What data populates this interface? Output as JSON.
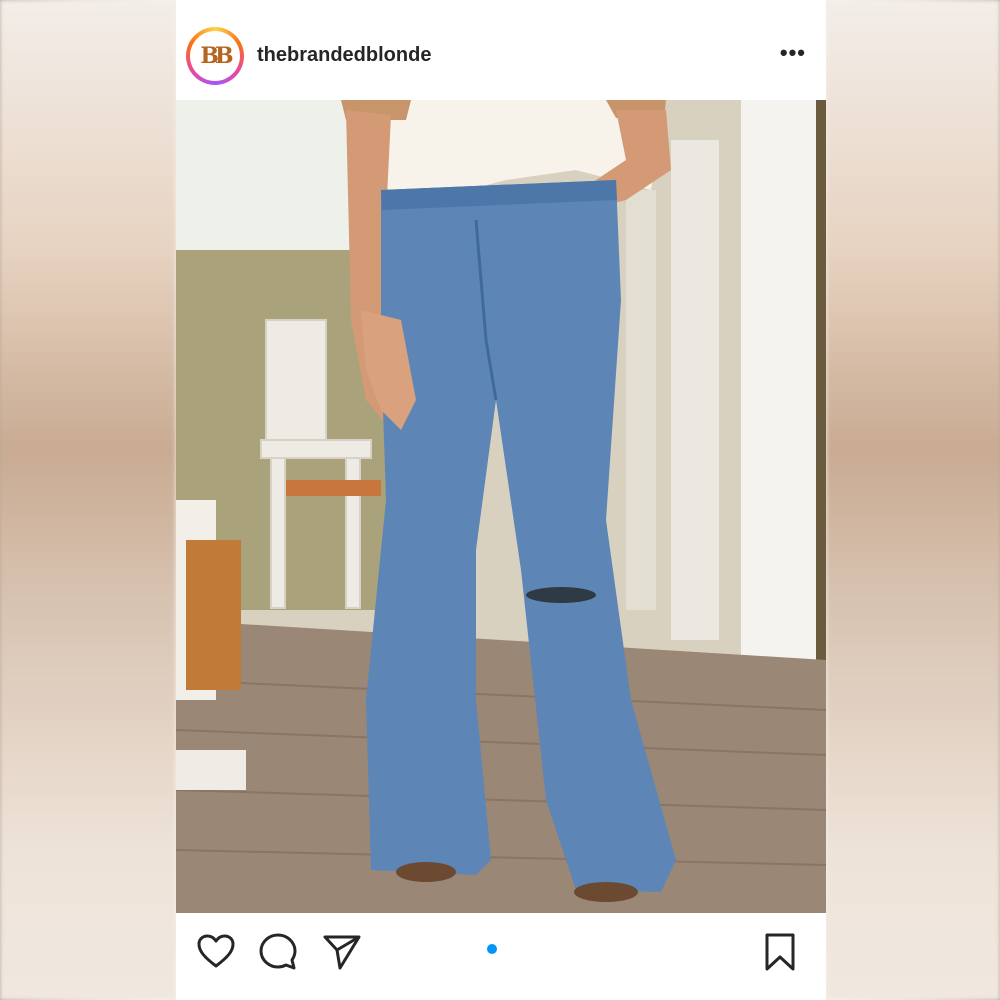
{
  "post": {
    "username": "thebrandedblonde",
    "avatar_monogram": "BB",
    "more_label": "•••",
    "photo_alt": "",
    "carousel_dots": 1
  },
  "actions": {
    "like": "heart-icon",
    "comment": "comment-icon",
    "share": "send-icon",
    "save": "bookmark-icon"
  },
  "colors": {
    "accent": "#0095f6",
    "text": "#262626"
  }
}
